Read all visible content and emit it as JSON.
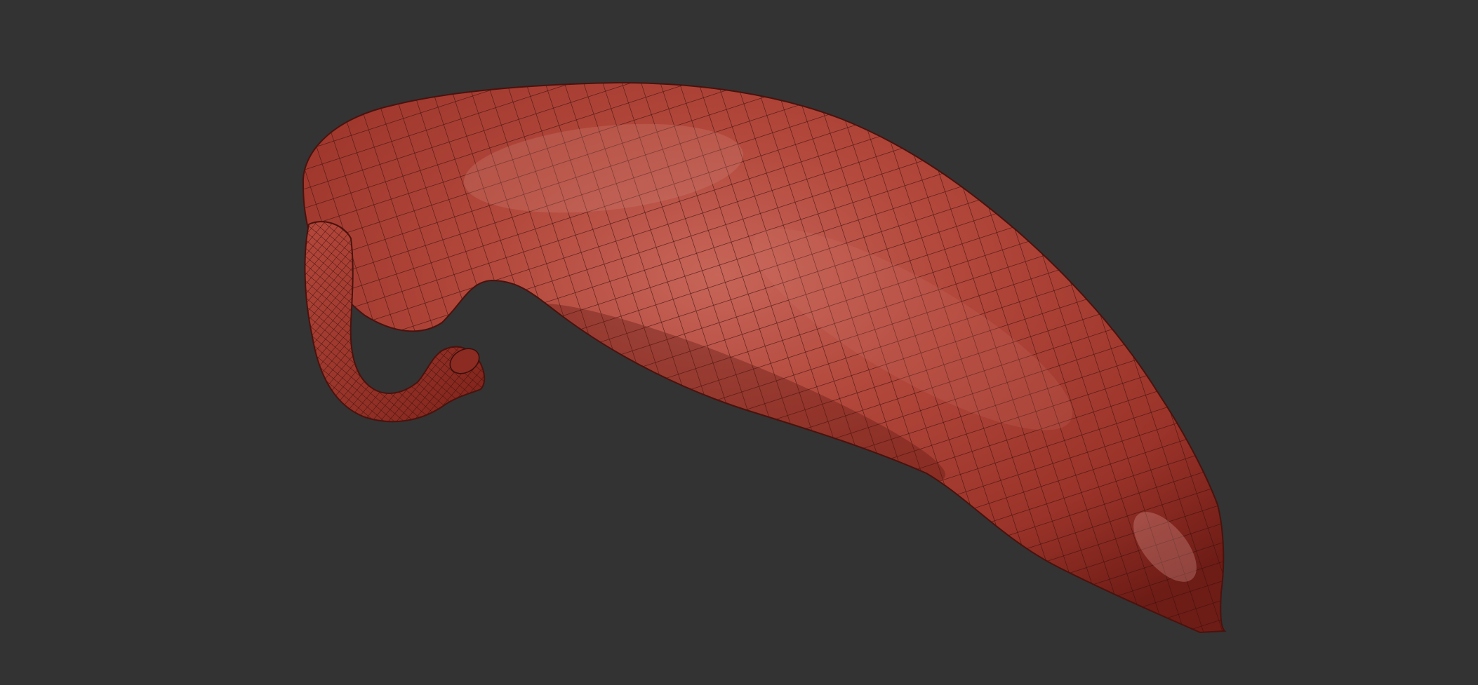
{
  "viewport": {
    "background_color": "#333333",
    "model": {
      "object": "chili-pepper-mesh",
      "display_mode": "polyframe-wireframe-overlay",
      "base_color": "#a8392e",
      "highlight_color": "#c98a80",
      "shadow_color": "#6e1c16",
      "wire_color": "#3a0e0b"
    }
  }
}
